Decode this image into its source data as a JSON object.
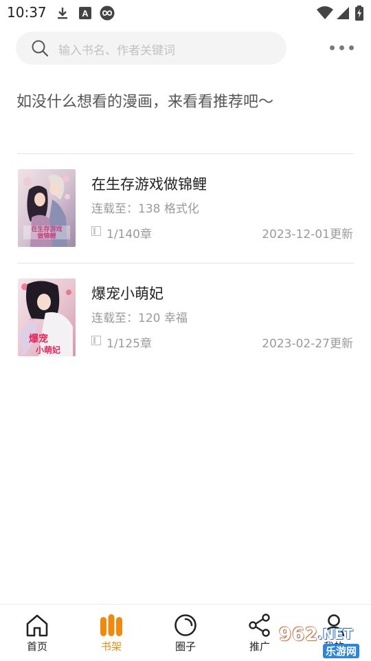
{
  "status_bar": {
    "time": "10:37",
    "left_icons": [
      "download-icon",
      "a-font-icon",
      "infinity-app-icon"
    ],
    "right_icons": [
      "wifi-icon",
      "signal-icon",
      "battery-charging-icon"
    ]
  },
  "search": {
    "placeholder": "输入书名、作者关键词"
  },
  "recommend_text": "如没什么想看的漫画，来看看推荐吧～",
  "books": [
    {
      "title": "在生存游戏做锦鲤",
      "serial": "连载至：138 格式化",
      "chapter": "1/140章",
      "updated": "2023-12-01更新",
      "cover_text": "在生存游戏做锦鲤"
    },
    {
      "title": "爆宠小萌妃",
      "serial": "连载至：120 幸福",
      "chapter": "1/125章",
      "updated": "2023-02-27更新",
      "cover_text": "爆宠小萌妃"
    }
  ],
  "bottom_nav": [
    {
      "label": "首页",
      "icon": "home-icon",
      "active": false
    },
    {
      "label": "书架",
      "icon": "bookshelf-icon",
      "active": true
    },
    {
      "label": "圈子",
      "icon": "circle-icon",
      "active": false
    },
    {
      "label": "推广",
      "icon": "share-icon",
      "active": false
    },
    {
      "label": "我的",
      "icon": "user-icon",
      "active": false
    }
  ],
  "colors": {
    "accent": "#f08a0c",
    "text_primary": "#222222",
    "text_secondary": "#9a9a9a",
    "search_bg": "#f4f4f4"
  },
  "watermark": {
    "number": "962",
    "suffix": ".NET",
    "site": "乐游网"
  }
}
